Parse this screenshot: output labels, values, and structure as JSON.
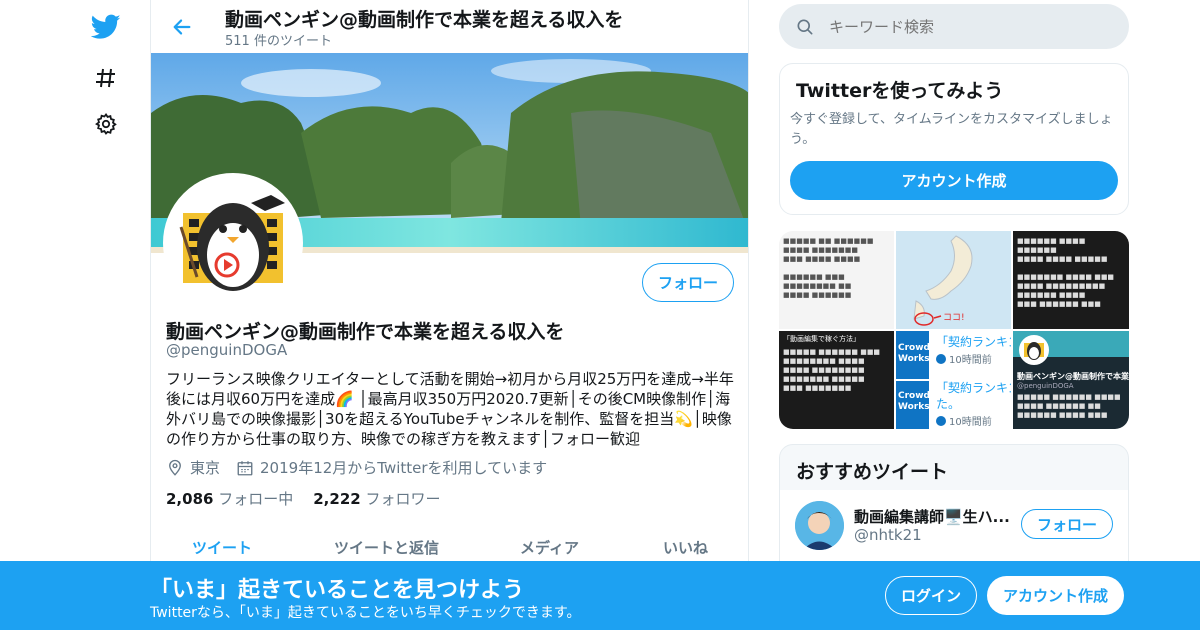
{
  "nav": {
    "icons": [
      "twitter-bird-icon",
      "hashtag-icon",
      "gear-icon"
    ]
  },
  "header": {
    "title": "動画ペンギン@動画制作で本業を超える収入を",
    "tweet_count": "511 件のツイート"
  },
  "profile": {
    "name": "動画ペンギン@動画制作で本業を超える収入を",
    "handle": "@penguinDOGA",
    "follow_label": "フォロー",
    "bio": "フリーランス映像クリエイターとして活動を開始→初月から月収25万円を達成→半年後には月収60万円を達成🌈 │最高月収350万円2020.7更新│その後CM映像制作│海外バリ島での映像撮影│30を超えるYouTubeチャンネルを制作、監督を担当💫│映像の作り方から仕事の取り方、映像での稼ぎ方を教えます│フォロー歓迎",
    "location": "東京",
    "joined": "2019年12月からTwitterを利用しています",
    "following_count": "2,086",
    "following_label": "フォロー中",
    "followers_count": "2,222",
    "followers_label": "フォロワー"
  },
  "tabs": [
    {
      "label": "ツイート",
      "active": true
    },
    {
      "label": "ツイートと返信",
      "active": false
    },
    {
      "label": "メディア",
      "active": false
    },
    {
      "label": "いいね",
      "active": false
    }
  ],
  "search": {
    "placeholder": "キーワード検索"
  },
  "signup_card": {
    "title": "Twitterを使ってみよう",
    "description": "今すぐ登録して、タイムラインをカスタマイズしましょう。",
    "button": "アカウント作成"
  },
  "media_grid": {
    "cells": [
      {
        "kind": "document-screenshot"
      },
      {
        "kind": "map",
        "annotation": "ココ!"
      },
      {
        "kind": "document-screenshot"
      },
      {
        "kind": "document-screenshot",
        "heading": "「動画編集で稼ぐ方法」"
      },
      {
        "kind": "link",
        "logo": "Crowd Works",
        "text": "「契約ランキン",
        "time": "10時間前"
      },
      {
        "kind": "profile-card",
        "name": "動画ペンギン@動画制作で本業を",
        "handle": "@penguinDOGA"
      },
      {
        "kind": "link",
        "logo": "Crowd Works",
        "text": "「契約ランキン",
        "text2": "た。",
        "time": "10時間前"
      }
    ]
  },
  "recommended": {
    "title": "おすすめツイート",
    "user_name": "動画編集講師🖥️生ハ...",
    "user_handle": "@nhtk21",
    "follow_label": "フォロー"
  },
  "bottom_bar": {
    "headline": "「いま」起きていることを見つけよう",
    "subtext": "Twitterなら、「いま」起きていることをいち早くチェックできます。",
    "login": "ログイン",
    "signup": "アカウント作成"
  },
  "colors": {
    "accent": "#1da1f2",
    "text": "#14171a",
    "muted": "#657786",
    "border": "#e6ecf0"
  }
}
